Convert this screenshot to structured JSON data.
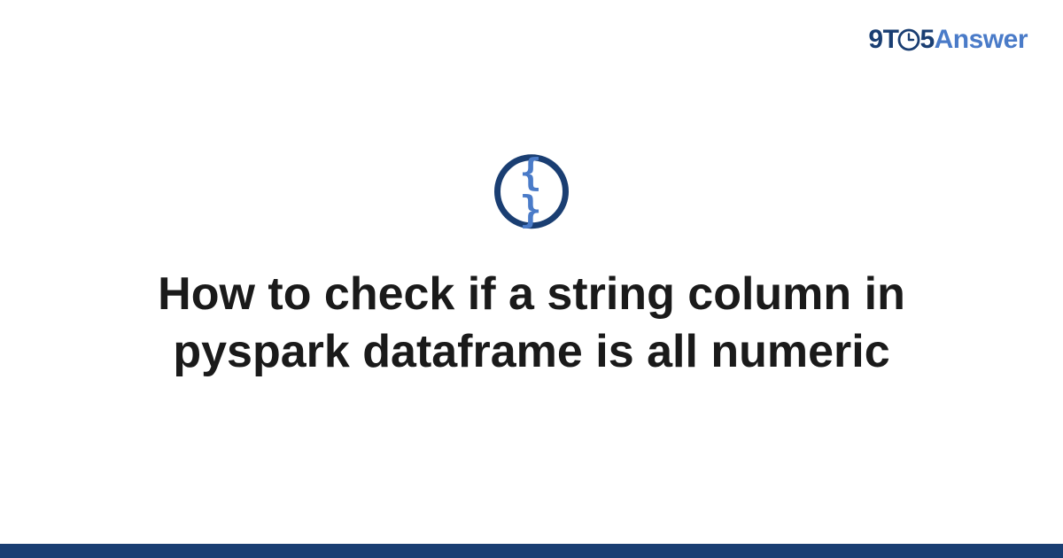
{
  "logo": {
    "prefix_9": "9",
    "prefix_t": "T",
    "prefix_5": "5",
    "suffix": "Answer"
  },
  "category_icon": {
    "name": "code-braces-icon",
    "glyph": "{ }"
  },
  "main": {
    "title": "How to check if a string column in pyspark dataframe is all numeric"
  },
  "colors": {
    "brand_dark": "#1a3e72",
    "brand_light": "#4a7bc8"
  }
}
